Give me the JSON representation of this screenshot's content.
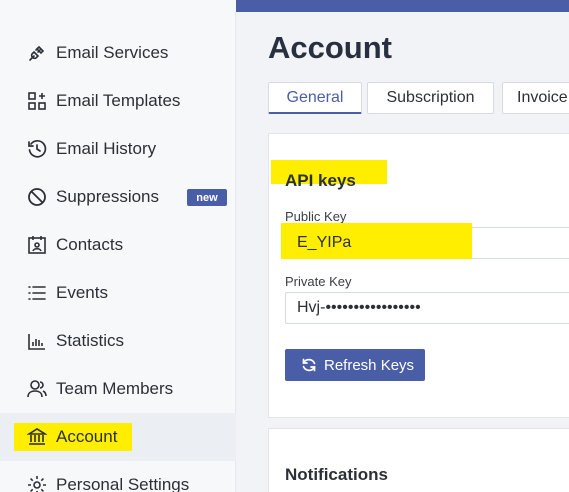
{
  "sidebar": {
    "items": [
      {
        "label": "Email Services",
        "icon": "plug-icon"
      },
      {
        "label": "Email Templates",
        "icon": "template-grid-icon"
      },
      {
        "label": "Email History",
        "icon": "history-clock-icon"
      },
      {
        "label": "Suppressions",
        "icon": "block-icon",
        "badge": "new"
      },
      {
        "label": "Contacts",
        "icon": "contact-card-icon"
      },
      {
        "label": "Events",
        "icon": "list-icon"
      },
      {
        "label": "Statistics",
        "icon": "bar-chart-icon"
      },
      {
        "label": "Team Members",
        "icon": "team-icon"
      },
      {
        "label": "Account",
        "icon": "bank-icon",
        "active": true
      },
      {
        "label": "Personal Settings",
        "icon": "gear-icon"
      }
    ]
  },
  "main": {
    "title": "Account",
    "tabs": [
      {
        "label": "General",
        "active": true
      },
      {
        "label": "Subscription"
      },
      {
        "label": "Invoice"
      }
    ],
    "api_keys": {
      "title": "API keys",
      "public_label": "Public Key",
      "public_value": "E_YIPa",
      "private_label": "Private Key",
      "private_value": "Hvj-•••••••••••••••••",
      "refresh_label": "Refresh Keys"
    },
    "notifications": {
      "title": "Notifications"
    }
  },
  "colors": {
    "accent": "#4a5ea8",
    "highlight": "#ffee00",
    "sidebar_bg": "#f7f8fa",
    "main_bg": "#f1f3f7"
  }
}
